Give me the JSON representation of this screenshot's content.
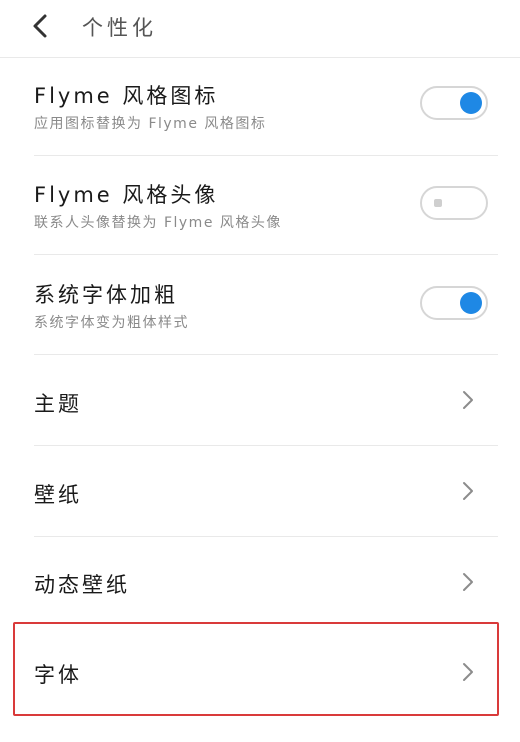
{
  "header": {
    "back_icon": "back-arrow-icon",
    "title": "个性化"
  },
  "toggles": [
    {
      "title": "Flyme 风格图标",
      "subtitle": "应用图标替换为 Flyme 风格图标",
      "state": "on"
    },
    {
      "title": "Flyme 风格头像",
      "subtitle": "联系人头像替换为 Flyme 风格头像",
      "state": "off"
    },
    {
      "title": "系统字体加粗",
      "subtitle": "系统字体变为粗体样式",
      "state": "on"
    }
  ],
  "links": [
    {
      "label": "主题",
      "icon": "chevron-right-icon"
    },
    {
      "label": "壁纸",
      "icon": "chevron-right-icon"
    },
    {
      "label": "动态壁纸",
      "icon": "chevron-right-icon"
    },
    {
      "label": "字体",
      "icon": "chevron-right-icon",
      "highlighted": true
    }
  ],
  "colors": {
    "accent": "#1e88e5",
    "highlight_border": "#d93a3a"
  }
}
